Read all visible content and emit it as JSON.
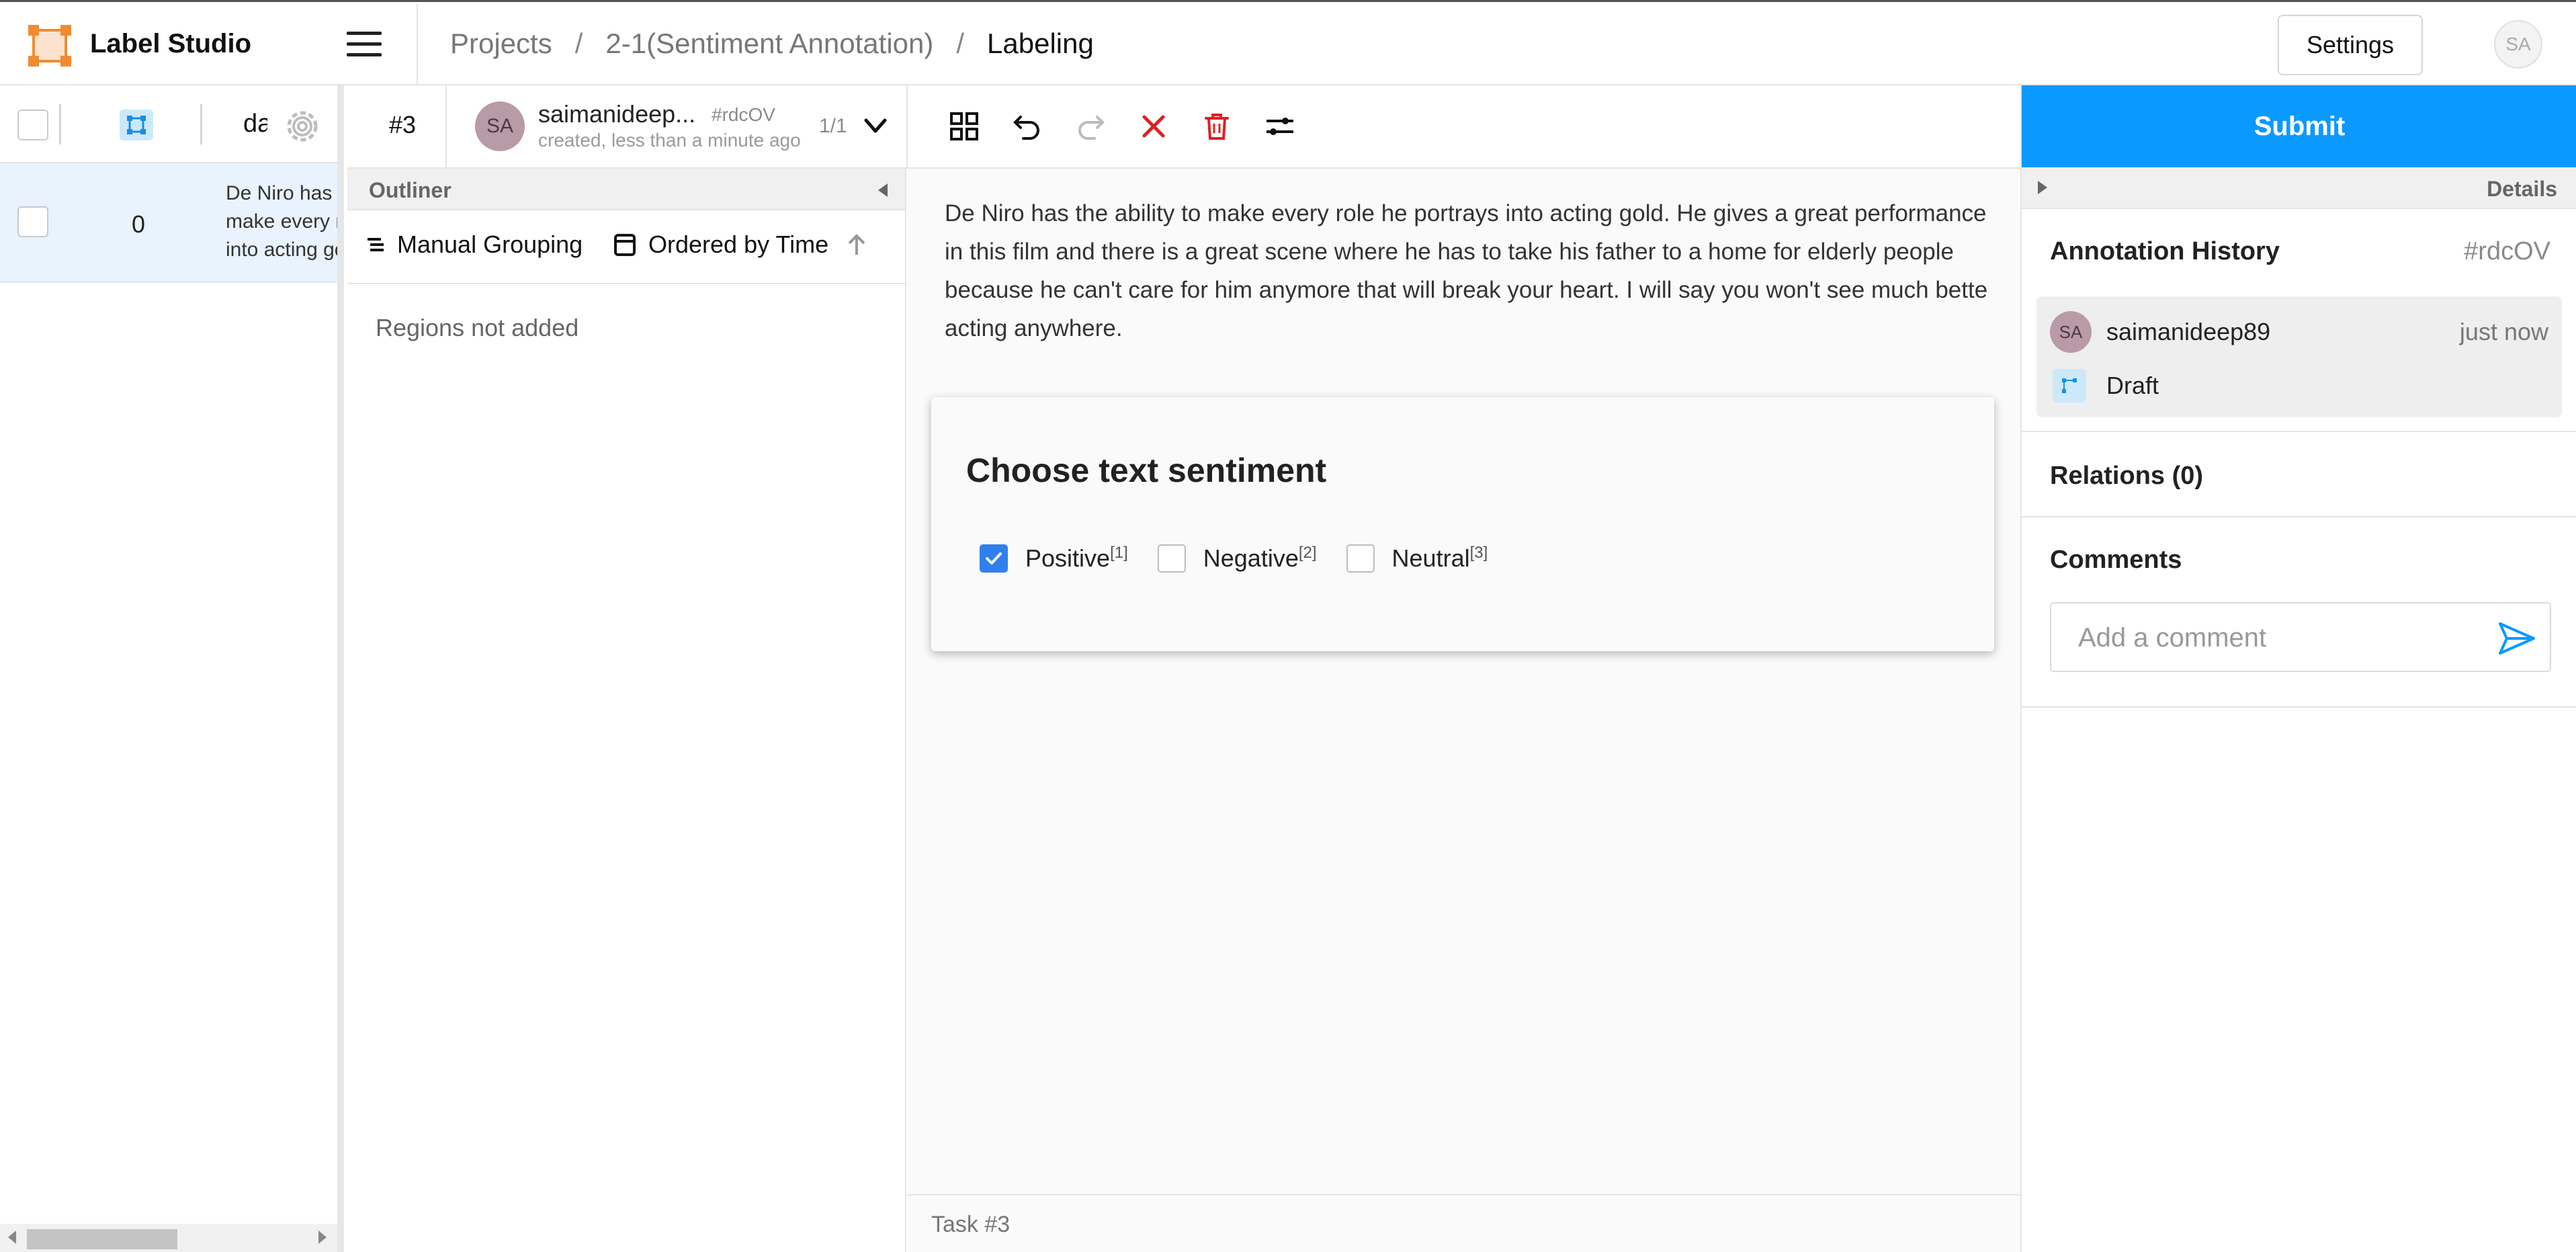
{
  "app": {
    "title": "Label Studio"
  },
  "breadcrumb": {
    "projects": "Projects",
    "project": "2-1(Sentiment Annotation)",
    "current": "Labeling",
    "sep": "/"
  },
  "header": {
    "settings_label": "Settings",
    "avatar_initials": "SA"
  },
  "tasklist": {
    "column_label": "da",
    "rows": [
      {
        "id": "0",
        "text": "De Niro has the\nmake every role\ninto acting gold"
      }
    ]
  },
  "annotation_bar": {
    "task_number": "#3",
    "avatar_initials": "SA",
    "user": "saimanideep...",
    "hash": "#rdcOV",
    "created": "created, less than a minute ago",
    "count": "1/1"
  },
  "outliner": {
    "title": "Outliner",
    "grouping_label": "Manual Grouping",
    "ordering_label": "Ordered by Time",
    "empty_text": "Regions not added"
  },
  "content": {
    "review_text": "De Niro has the ability to make every role he portrays into acting gold. He gives a great performance in this film and there is a great scene where he has to take his father to a home for elderly people because he can't care for him anymore that will break your heart. I will say you won't see much bette acting anywhere.",
    "choice_title": "Choose text sentiment",
    "choices": [
      {
        "label": "Positive",
        "hotkey": "[1]",
        "checked": true
      },
      {
        "label": "Negative",
        "hotkey": "[2]",
        "checked": false
      },
      {
        "label": "Neutral",
        "hotkey": "[3]",
        "checked": false
      }
    ],
    "footer": "Task #3"
  },
  "right_panel": {
    "submit_label": "Submit",
    "details_label": "Details",
    "history": {
      "title": "Annotation History",
      "hash": "#rdcOV",
      "avatar_initials": "SA",
      "user": "saimanideep89",
      "time": "just now",
      "status": "Draft"
    },
    "relations_label": "Relations (0)",
    "comments": {
      "title": "Comments",
      "placeholder": "Add a comment"
    }
  },
  "colors": {
    "accent": "#0a99ff",
    "checkbox_checked": "#2f80ed",
    "delete_red": "#e02020",
    "avatar": "#b99aa7",
    "logo": "#f28b30"
  }
}
